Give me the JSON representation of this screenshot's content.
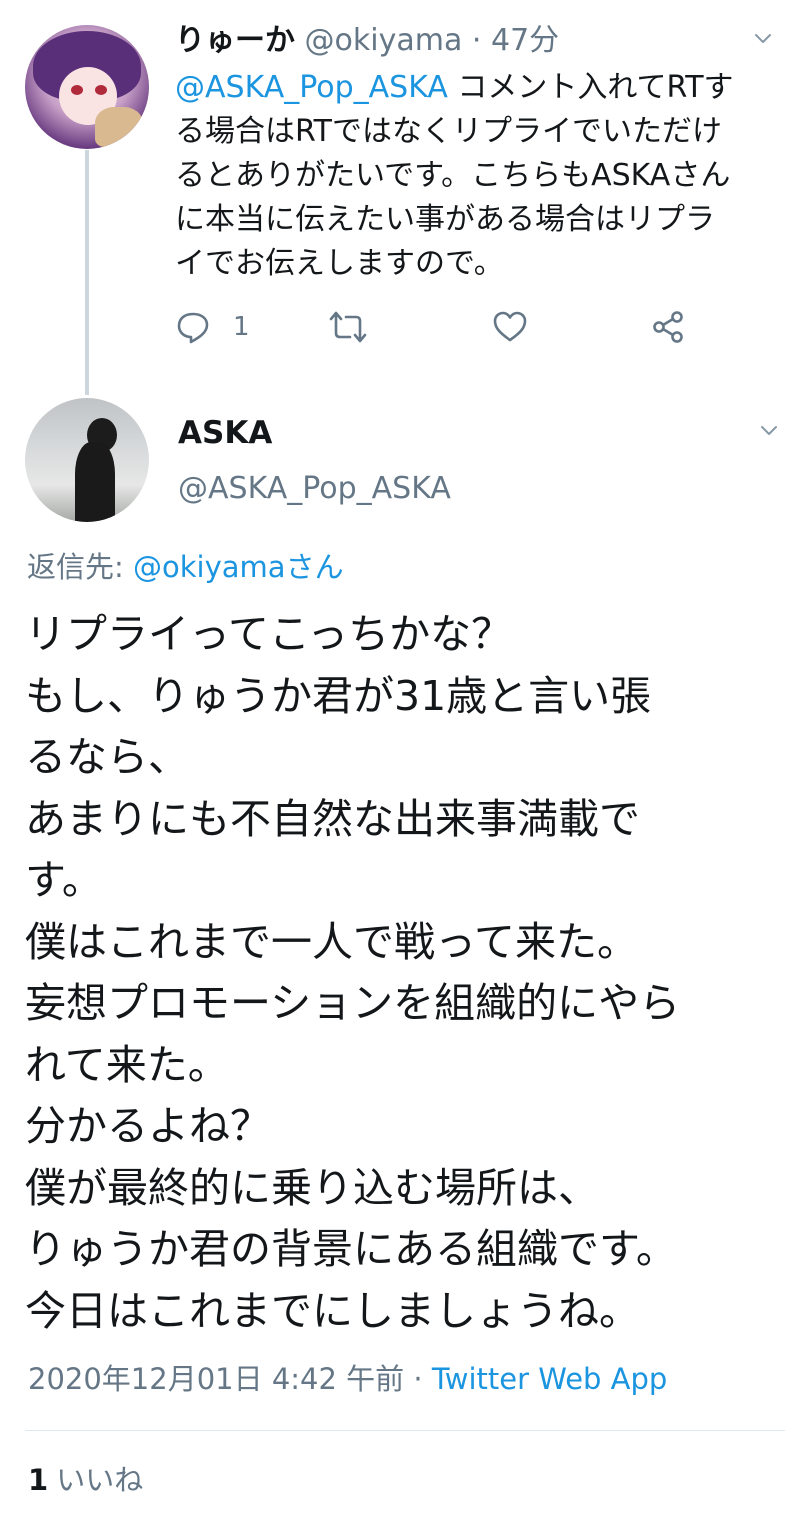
{
  "reply_tweet": {
    "display_name": "りゅーか",
    "handle": "@okiyama",
    "separator": "·",
    "time": "47分",
    "body": {
      "mention": "@ASKA_Pop_ASKA",
      "line1_rest": " コメント入れてRTす",
      "line2": "る場合はRTではなくリプライでいただけ",
      "line3": "るとありがたいです。こちらもASKAさん",
      "line4": "に本当に伝えたい事がある場合はリプラ",
      "line5": "イでお伝えしますので。"
    },
    "actions": {
      "reply_count": "1",
      "reply_icon": "reply-icon",
      "retweet_icon": "retweet-icon",
      "like_icon": "heart-icon",
      "share_icon": "share-icon"
    }
  },
  "main_tweet": {
    "display_name": "ASKA",
    "handle": "@ASKA_Pop_ASKA",
    "replying_to": {
      "prefix": "返信先: ",
      "mention": "@okiyama",
      "suffix": "さん"
    },
    "body_lines": [
      "リプライってこっちかな？",
      "もし、りゅうか君が31歳と言い張",
      "るなら、",
      "あまりにも不自然な出来事満載で",
      "す。",
      "僕はこれまで一人で戦って来た。",
      "妄想プロモーションを組織的にやら",
      "れて来た。",
      "分かるよね？",
      "僕が最終的に乗り込む場所は、",
      "りゅうか君の背景にある組織です。",
      "今日はこれまでにしましょうね。"
    ],
    "timestamp": "2020年12月01日 4:42 午前",
    "separator": " · ",
    "source": "Twitter Web App",
    "likes_count": "1",
    "likes_label": "いいね"
  },
  "colors": {
    "text": "#14171a",
    "secondary": "#657786",
    "link": "#1b95e0",
    "divider": "#e1e8ed",
    "thread_line": "#ccd6dd"
  }
}
